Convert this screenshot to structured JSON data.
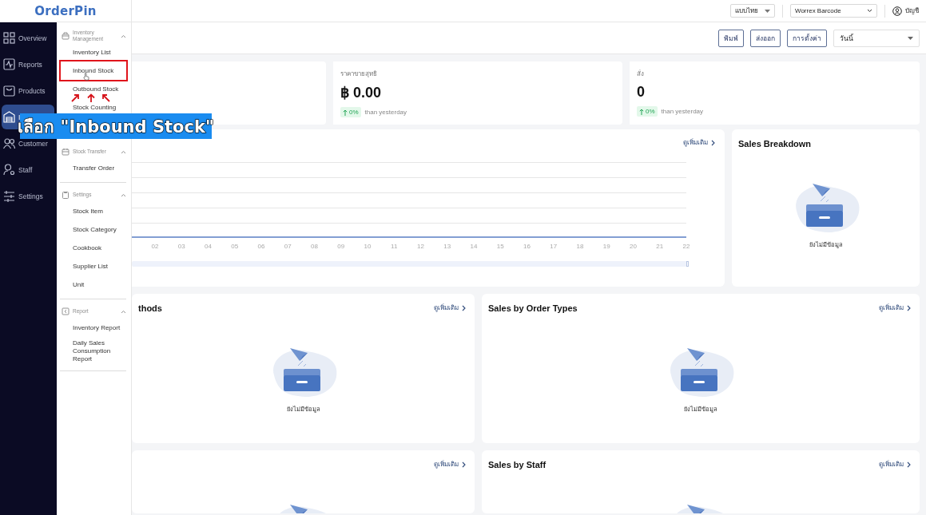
{
  "logo": {
    "text": "OrderPin"
  },
  "sidebar": {
    "items": [
      {
        "label": "Overview",
        "selected": false
      },
      {
        "label": "Reports",
        "selected": false
      },
      {
        "label": "Products",
        "selected": false
      },
      {
        "label": "I",
        "selected": true
      },
      {
        "label": "Customer",
        "selected": false
      },
      {
        "label": "Staff",
        "selected": false
      },
      {
        "label": "Settings",
        "selected": false
      }
    ]
  },
  "submenu": {
    "groups": [
      {
        "title": "Inventory Management",
        "expanded": true,
        "items": [
          {
            "label": "Inventory List",
            "selected": false
          },
          {
            "label": "Inbound Stock",
            "selected": false
          },
          {
            "label": "Outbound Stock",
            "selected": false
          },
          {
            "label": "Stock Counting",
            "selected": false
          }
        ]
      },
      {
        "title": "Stock Transfer",
        "expanded": true,
        "items": [
          {
            "label": "Transfer Order",
            "selected": false
          }
        ]
      },
      {
        "title": "Settings",
        "expanded": true,
        "items": [
          {
            "label": "Stock Item",
            "selected": false
          },
          {
            "label": "Stock Category",
            "selected": false
          },
          {
            "label": "Cookbook",
            "selected": false
          },
          {
            "label": "Supplier List",
            "selected": false
          },
          {
            "label": "Unit",
            "selected": false
          }
        ]
      },
      {
        "title": "Report",
        "expanded": true,
        "items": [
          {
            "label": "Inventory Report",
            "selected": false
          },
          {
            "label": "Daily Sales Consumption Report",
            "selected": false
          }
        ]
      }
    ]
  },
  "topbar": {
    "language": "แบบไทย",
    "store": "Worrex Barcode",
    "account": "บัญชี"
  },
  "toolbar": {
    "buttons": [
      "พิมพ์",
      "ส่งออก",
      "การตั้งค่า"
    ],
    "date_range": "วันนี้"
  },
  "stat_cards": [
    {
      "label": "ราคาขายสุทธิ",
      "value": "฿ 0.00",
      "change": "0%",
      "comparison": "than yesterday"
    },
    {
      "label": "สั่ง",
      "value": "0",
      "change": "0%",
      "comparison": "than yesterday"
    }
  ],
  "chart_panel": {
    "link": "ดูเพิ่มเติม",
    "x_labels": [
      "02",
      "03",
      "04",
      "05",
      "06",
      "07",
      "08",
      "09",
      "10",
      "11",
      "12",
      "13",
      "14",
      "15",
      "16",
      "17",
      "18",
      "19",
      "20",
      "21",
      "22"
    ]
  },
  "panels": [
    {
      "title": "Sales Breakdown",
      "empty_text": "ยังไม่มีข้อมูล"
    },
    {
      "title": "thods",
      "link": "ดูเพิ่มเติม",
      "empty_text": "ยังไม่มีข้อมูล"
    },
    {
      "title": "Sales by Order Types",
      "link": "ดูเพิ่มเติม",
      "empty_text": "ยังไม่มีข้อมูล"
    },
    {
      "link": "ดูเพิ่มเติม"
    },
    {
      "title": "Sales by Staff",
      "link": "ดูเพิ่มเติม"
    }
  ],
  "annotation": {
    "caption": "เลือก \"Inbound Stock\""
  }
}
